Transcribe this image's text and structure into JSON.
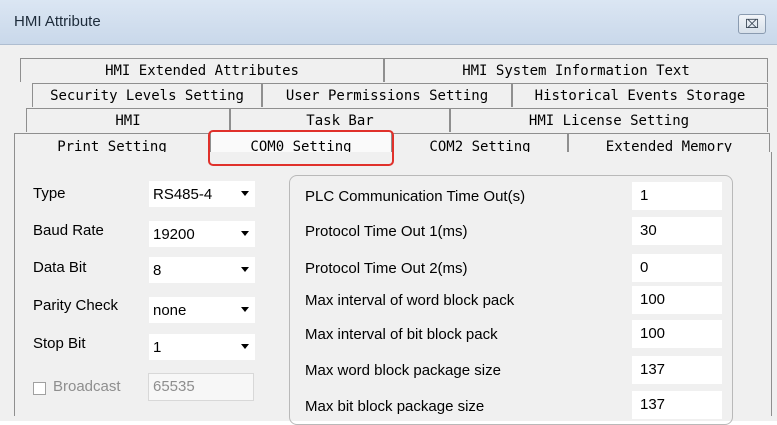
{
  "window": {
    "title": "HMI Attribute",
    "close_glyph": "⌧"
  },
  "tabs": {
    "row1": [
      "HMI Extended Attributes",
      "HMI System Information Text"
    ],
    "row2": [
      "Security Levels Setting",
      "User Permissions Setting",
      "Historical Events Storage"
    ],
    "row3": [
      "HMI",
      "Task Bar",
      "HMI License Setting"
    ],
    "row4": [
      "Print Setting",
      "COM0 Setting",
      "COM2 Setting",
      "Extended Memory"
    ],
    "active": "COM0 Setting"
  },
  "left_fields": [
    {
      "label": "Type",
      "value": "RS485-4"
    },
    {
      "label": "Baud Rate",
      "value": "19200"
    },
    {
      "label": "Data Bit",
      "value": "8"
    },
    {
      "label": "Parity Check",
      "value": "none"
    },
    {
      "label": "Stop Bit",
      "value": "1"
    }
  ],
  "broadcast": {
    "label": "Broadcast",
    "value": "65535",
    "checked": false
  },
  "timeouts": [
    {
      "label": "PLC Communication Time Out(s)",
      "value": "1"
    },
    {
      "label": "Protocol Time Out 1(ms)",
      "value": "30"
    },
    {
      "label": "Protocol Time Out 2(ms)",
      "value": "0"
    },
    {
      "label": "Max interval of word block pack",
      "value": "100"
    },
    {
      "label": "Max interval of bit block pack",
      "value": "100"
    },
    {
      "label": "Max word block package size",
      "value": "137"
    },
    {
      "label": "Max bit block package size",
      "value": "137"
    }
  ],
  "colors": {
    "highlight": "#e0312b",
    "titlebar": "#c9d8ea",
    "dialog_bg": "#f0f0f0"
  }
}
